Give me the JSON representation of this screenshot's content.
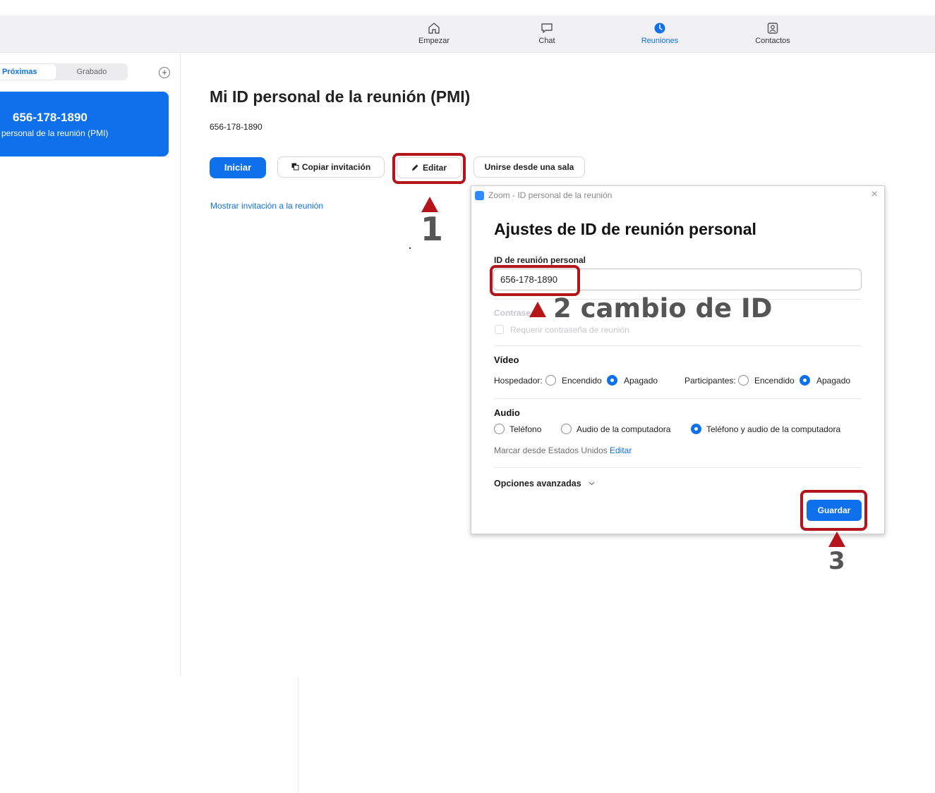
{
  "nav": {
    "items": [
      {
        "label": "Empezar",
        "icon": "home-icon"
      },
      {
        "label": "Chat",
        "icon": "chat-icon"
      },
      {
        "label": "Reuniones",
        "icon": "clock-icon",
        "active": true
      },
      {
        "label": "Contactos",
        "icon": "contacts-icon"
      }
    ]
  },
  "sidebar": {
    "tabs": [
      "Próximas",
      "Grabado"
    ],
    "add_label": "+",
    "meeting": {
      "id": "656-178-1890",
      "subtitle": "D personal de la reunión (PMI)"
    }
  },
  "main": {
    "title": "Mi ID personal de la reunión (PMI)",
    "pmi": "656-178-1890",
    "buttons": {
      "start": "Iniciar",
      "copy": "Copiar invitación",
      "edit": "Editar",
      "room": "Unirse desde una sala"
    },
    "show_invitation": "Mostrar invitación a la reunión"
  },
  "dialog": {
    "window_title": "Zoom - ID personal de la reunión",
    "close": "×",
    "heading": "Ajustes de ID de reunión personal",
    "id_label": "ID de reunión personal",
    "id_value": "656-178-1890",
    "password_label": "Contrase",
    "require_password": "Requerir contraseña de reunión",
    "video": {
      "label": "Vídeo",
      "host_label": "Hospedador:",
      "participants_label": "Participantes:",
      "on": "Encendido",
      "off": "Apagado",
      "host_value": "Apagado",
      "participants_value": "Apagado"
    },
    "audio": {
      "label": "Audio",
      "options": [
        "Teléfono",
        "Audio de la computadora",
        "Teléfono y audio de la computadora"
      ],
      "selected": "Teléfono y audio de la computadora",
      "dial_from": "Marcar desde Estados Unidos",
      "edit": "Editar"
    },
    "advanced": "Opciones avanzadas",
    "save": "Guardar"
  },
  "annotations": {
    "step1": "1",
    "step2": "2 cambio de ID",
    "step3": "3",
    "color": "#b3151b"
  }
}
